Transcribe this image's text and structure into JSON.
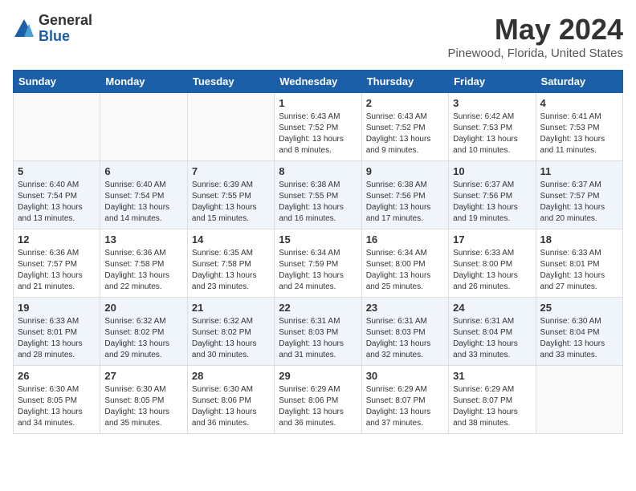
{
  "header": {
    "logo_general": "General",
    "logo_blue": "Blue",
    "month": "May 2024",
    "location": "Pinewood, Florida, United States"
  },
  "weekdays": [
    "Sunday",
    "Monday",
    "Tuesday",
    "Wednesday",
    "Thursday",
    "Friday",
    "Saturday"
  ],
  "weeks": [
    [
      {
        "day": "",
        "sunrise": "",
        "sunset": "",
        "daylight": ""
      },
      {
        "day": "",
        "sunrise": "",
        "sunset": "",
        "daylight": ""
      },
      {
        "day": "",
        "sunrise": "",
        "sunset": "",
        "daylight": ""
      },
      {
        "day": "1",
        "sunrise": "Sunrise: 6:43 AM",
        "sunset": "Sunset: 7:52 PM",
        "daylight": "Daylight: 13 hours and 8 minutes."
      },
      {
        "day": "2",
        "sunrise": "Sunrise: 6:43 AM",
        "sunset": "Sunset: 7:52 PM",
        "daylight": "Daylight: 13 hours and 9 minutes."
      },
      {
        "day": "3",
        "sunrise": "Sunrise: 6:42 AM",
        "sunset": "Sunset: 7:53 PM",
        "daylight": "Daylight: 13 hours and 10 minutes."
      },
      {
        "day": "4",
        "sunrise": "Sunrise: 6:41 AM",
        "sunset": "Sunset: 7:53 PM",
        "daylight": "Daylight: 13 hours and 11 minutes."
      }
    ],
    [
      {
        "day": "5",
        "sunrise": "Sunrise: 6:40 AM",
        "sunset": "Sunset: 7:54 PM",
        "daylight": "Daylight: 13 hours and 13 minutes."
      },
      {
        "day": "6",
        "sunrise": "Sunrise: 6:40 AM",
        "sunset": "Sunset: 7:54 PM",
        "daylight": "Daylight: 13 hours and 14 minutes."
      },
      {
        "day": "7",
        "sunrise": "Sunrise: 6:39 AM",
        "sunset": "Sunset: 7:55 PM",
        "daylight": "Daylight: 13 hours and 15 minutes."
      },
      {
        "day": "8",
        "sunrise": "Sunrise: 6:38 AM",
        "sunset": "Sunset: 7:55 PM",
        "daylight": "Daylight: 13 hours and 16 minutes."
      },
      {
        "day": "9",
        "sunrise": "Sunrise: 6:38 AM",
        "sunset": "Sunset: 7:56 PM",
        "daylight": "Daylight: 13 hours and 17 minutes."
      },
      {
        "day": "10",
        "sunrise": "Sunrise: 6:37 AM",
        "sunset": "Sunset: 7:56 PM",
        "daylight": "Daylight: 13 hours and 19 minutes."
      },
      {
        "day": "11",
        "sunrise": "Sunrise: 6:37 AM",
        "sunset": "Sunset: 7:57 PM",
        "daylight": "Daylight: 13 hours and 20 minutes."
      }
    ],
    [
      {
        "day": "12",
        "sunrise": "Sunrise: 6:36 AM",
        "sunset": "Sunset: 7:57 PM",
        "daylight": "Daylight: 13 hours and 21 minutes."
      },
      {
        "day": "13",
        "sunrise": "Sunrise: 6:36 AM",
        "sunset": "Sunset: 7:58 PM",
        "daylight": "Daylight: 13 hours and 22 minutes."
      },
      {
        "day": "14",
        "sunrise": "Sunrise: 6:35 AM",
        "sunset": "Sunset: 7:58 PM",
        "daylight": "Daylight: 13 hours and 23 minutes."
      },
      {
        "day": "15",
        "sunrise": "Sunrise: 6:34 AM",
        "sunset": "Sunset: 7:59 PM",
        "daylight": "Daylight: 13 hours and 24 minutes."
      },
      {
        "day": "16",
        "sunrise": "Sunrise: 6:34 AM",
        "sunset": "Sunset: 8:00 PM",
        "daylight": "Daylight: 13 hours and 25 minutes."
      },
      {
        "day": "17",
        "sunrise": "Sunrise: 6:33 AM",
        "sunset": "Sunset: 8:00 PM",
        "daylight": "Daylight: 13 hours and 26 minutes."
      },
      {
        "day": "18",
        "sunrise": "Sunrise: 6:33 AM",
        "sunset": "Sunset: 8:01 PM",
        "daylight": "Daylight: 13 hours and 27 minutes."
      }
    ],
    [
      {
        "day": "19",
        "sunrise": "Sunrise: 6:33 AM",
        "sunset": "Sunset: 8:01 PM",
        "daylight": "Daylight: 13 hours and 28 minutes."
      },
      {
        "day": "20",
        "sunrise": "Sunrise: 6:32 AM",
        "sunset": "Sunset: 8:02 PM",
        "daylight": "Daylight: 13 hours and 29 minutes."
      },
      {
        "day": "21",
        "sunrise": "Sunrise: 6:32 AM",
        "sunset": "Sunset: 8:02 PM",
        "daylight": "Daylight: 13 hours and 30 minutes."
      },
      {
        "day": "22",
        "sunrise": "Sunrise: 6:31 AM",
        "sunset": "Sunset: 8:03 PM",
        "daylight": "Daylight: 13 hours and 31 minutes."
      },
      {
        "day": "23",
        "sunrise": "Sunrise: 6:31 AM",
        "sunset": "Sunset: 8:03 PM",
        "daylight": "Daylight: 13 hours and 32 minutes."
      },
      {
        "day": "24",
        "sunrise": "Sunrise: 6:31 AM",
        "sunset": "Sunset: 8:04 PM",
        "daylight": "Daylight: 13 hours and 33 minutes."
      },
      {
        "day": "25",
        "sunrise": "Sunrise: 6:30 AM",
        "sunset": "Sunset: 8:04 PM",
        "daylight": "Daylight: 13 hours and 33 minutes."
      }
    ],
    [
      {
        "day": "26",
        "sunrise": "Sunrise: 6:30 AM",
        "sunset": "Sunset: 8:05 PM",
        "daylight": "Daylight: 13 hours and 34 minutes."
      },
      {
        "day": "27",
        "sunrise": "Sunrise: 6:30 AM",
        "sunset": "Sunset: 8:05 PM",
        "daylight": "Daylight: 13 hours and 35 minutes."
      },
      {
        "day": "28",
        "sunrise": "Sunrise: 6:30 AM",
        "sunset": "Sunset: 8:06 PM",
        "daylight": "Daylight: 13 hours and 36 minutes."
      },
      {
        "day": "29",
        "sunrise": "Sunrise: 6:29 AM",
        "sunset": "Sunset: 8:06 PM",
        "daylight": "Daylight: 13 hours and 36 minutes."
      },
      {
        "day": "30",
        "sunrise": "Sunrise: 6:29 AM",
        "sunset": "Sunset: 8:07 PM",
        "daylight": "Daylight: 13 hours and 37 minutes."
      },
      {
        "day": "31",
        "sunrise": "Sunrise: 6:29 AM",
        "sunset": "Sunset: 8:07 PM",
        "daylight": "Daylight: 13 hours and 38 minutes."
      },
      {
        "day": "",
        "sunrise": "",
        "sunset": "",
        "daylight": ""
      }
    ]
  ]
}
